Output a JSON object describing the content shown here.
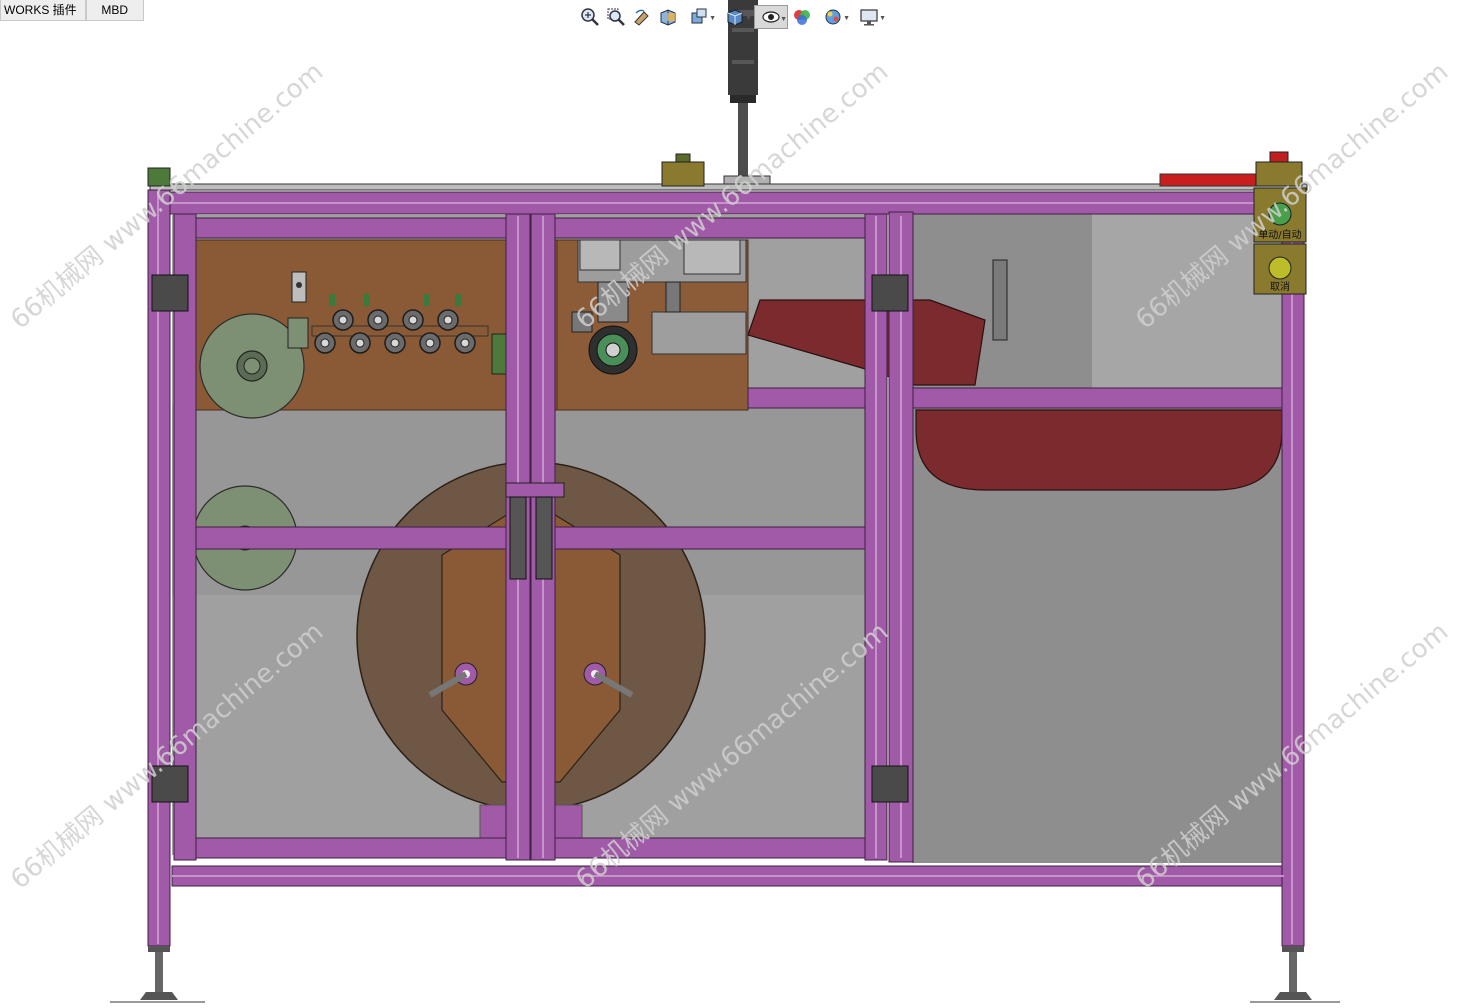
{
  "tabs": [
    {
      "label": "WORKS 插件"
    },
    {
      "label": "MBD"
    }
  ],
  "toolbar": {
    "icons": [
      "zoom-to-fit-icon",
      "zoom-to-area-icon",
      "previous-view-icon",
      "section-view-icon",
      "dynamic-annotation-icon",
      "view-orientation-icon",
      "display-style-icon",
      "hide-show-icon",
      "edit-appearance-icon",
      "apply-scene-icon",
      "view-settings-icon"
    ]
  },
  "panel": {
    "button1_label": "单动/自动",
    "button2_label": "取消"
  },
  "watermark": {
    "text": "66机械网 www.66machine.com"
  },
  "colors": {
    "frame": "#a15aa8",
    "frame_dark": "#6d3574",
    "brown_plate": "#8a5a36",
    "red_part": "#7b2a2e",
    "gray_panel": "#8e8e8e",
    "spool": "#6e5845"
  }
}
